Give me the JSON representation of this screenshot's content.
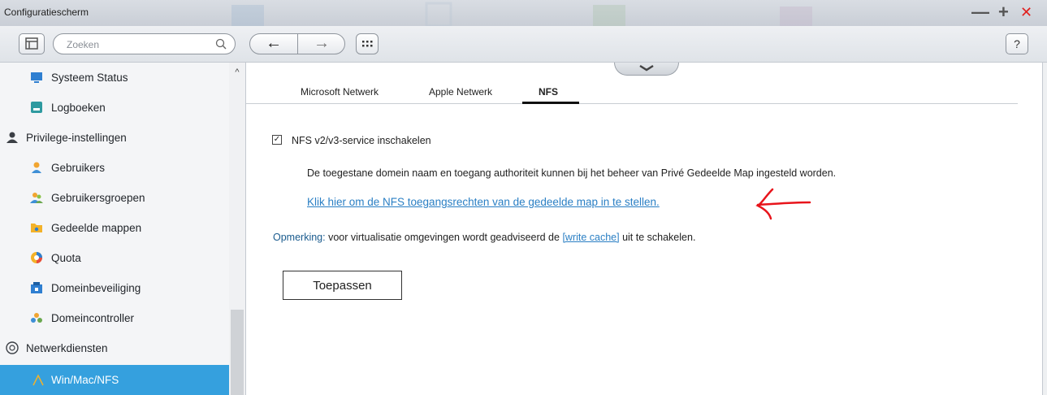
{
  "window": {
    "title": "Configuratiescherm",
    "controls": {
      "minimize": "—",
      "maximize": "+",
      "close": "✕"
    }
  },
  "toolbar": {
    "search_placeholder": "Zoeken",
    "back_glyph": "←",
    "forward_glyph": "→",
    "help_label": "?"
  },
  "sidebar": {
    "items": [
      {
        "label": "Systeem Status",
        "icon": "monitor-icon",
        "type": "child"
      },
      {
        "label": "Logboeken",
        "icon": "log-icon",
        "type": "child"
      },
      {
        "label": "Privilege-instellingen",
        "icon": "person-icon",
        "type": "section"
      },
      {
        "label": "Gebruikers",
        "icon": "user-icon",
        "type": "child"
      },
      {
        "label": "Gebruikersgroepen",
        "icon": "user-group-icon",
        "type": "child"
      },
      {
        "label": "Gedeelde mappen",
        "icon": "shared-folder-icon",
        "type": "child"
      },
      {
        "label": "Quota",
        "icon": "quota-pie-icon",
        "type": "child"
      },
      {
        "label": "Domeinbeveiliging",
        "icon": "domain-security-icon",
        "type": "child"
      },
      {
        "label": "Domeincontroller",
        "icon": "domain-controller-icon",
        "type": "child"
      },
      {
        "label": "Netwerkdiensten",
        "icon": "network-services-icon",
        "type": "section"
      },
      {
        "label": "Win/Mac/NFS",
        "icon": "winmacnfs-icon",
        "type": "child",
        "active": true
      }
    ]
  },
  "main": {
    "tabs": [
      {
        "label": "Microsoft Netwerk",
        "active": false
      },
      {
        "label": "Apple Netwerk",
        "active": false
      },
      {
        "label": "NFS",
        "active": true
      }
    ],
    "enable_checkbox": {
      "label": "NFS v2/v3-service inschakelen",
      "checked": true
    },
    "description": "De toegestane domein naam en toegang authoriteit kunnen bij het beheer van Privé Gedeelde Map ingesteld worden.",
    "nfs_link": "Klik hier om de NFS toegangsrechten van de gedeelde map in te stellen.",
    "note": {
      "label": "Opmerking:",
      "text_before": " voor virtualisatie omgevingen wordt geadviseerd de ",
      "link": "[write cache]",
      "text_after": " uit te schakelen."
    },
    "apply_button": "Toepassen"
  },
  "colors": {
    "accent": "#35a0de",
    "link": "#2a7fc4",
    "close_red": "#e0211f",
    "annotation_red": "#e8141b"
  }
}
